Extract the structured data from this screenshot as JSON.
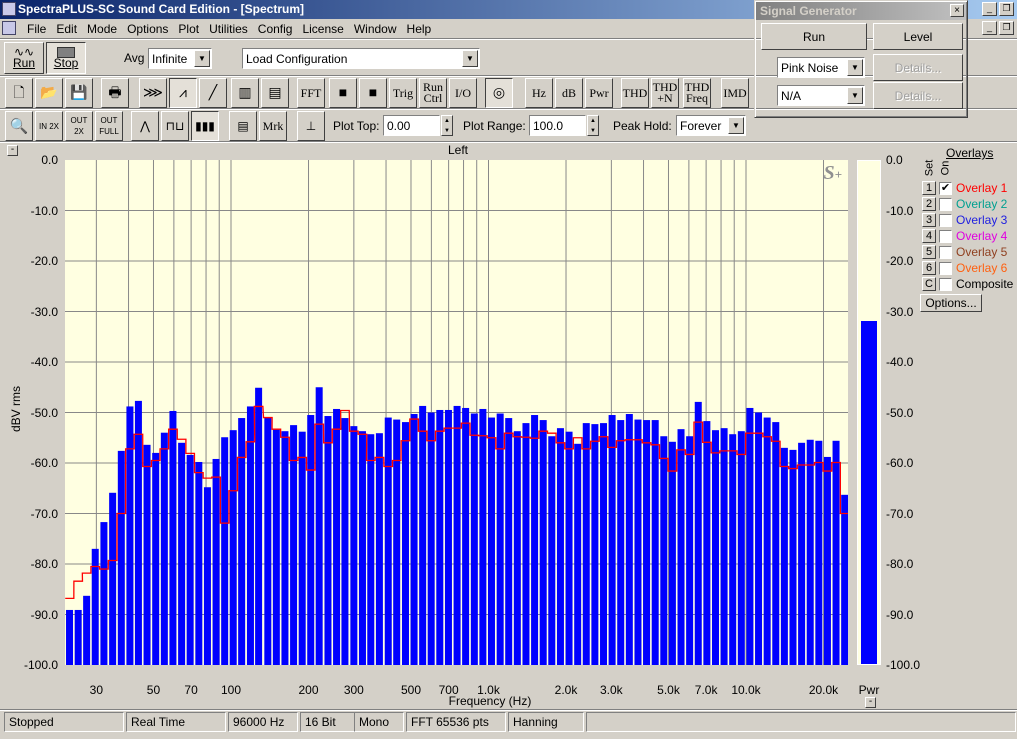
{
  "window": {
    "title": "SpectraPLUS-SC Sound Card Edition - [Spectrum]"
  },
  "menu": [
    "File",
    "Edit",
    "Mode",
    "Options",
    "Plot",
    "Utilities",
    "Config",
    "License",
    "Window",
    "Help"
  ],
  "toolbar1": {
    "run": "Run",
    "stop": "Stop",
    "avg_label": "Avg",
    "avg_value": "Infinite",
    "config_value": "Load Configuration"
  },
  "toolbar2": [
    {
      "name": "new-icon",
      "label": ""
    },
    {
      "name": "open-icon",
      "label": ""
    },
    {
      "name": "save-icon",
      "label": ""
    },
    {
      "name": "print-icon",
      "label": ""
    },
    {
      "name": "time-series-icon",
      "label": ""
    },
    {
      "name": "spectrum-icon",
      "label": ""
    },
    {
      "name": "phase-icon",
      "label": ""
    },
    {
      "name": "spectrogram-icon",
      "label": ""
    },
    {
      "name": "3d-surface-icon",
      "label": ""
    },
    {
      "name": "fft-button",
      "label": "FFT"
    },
    {
      "name": "scale-icon",
      "label": ""
    },
    {
      "name": "calibrate-icon",
      "label": ""
    },
    {
      "name": "trig-button",
      "label": "Trig"
    },
    {
      "name": "run-ctrl-button",
      "label": "Run Ctrl"
    },
    {
      "name": "io-button",
      "label": "I/O"
    },
    {
      "name": "generator-icon",
      "label": ""
    },
    {
      "name": "hz-button",
      "label": "Hz"
    },
    {
      "name": "db-button",
      "label": "dB"
    },
    {
      "name": "pwr-button",
      "label": "Pwr"
    },
    {
      "name": "thd-button",
      "label": "THD"
    },
    {
      "name": "thd-n-button",
      "label": "THD +N"
    },
    {
      "name": "thd-freq-button",
      "label": "THD Freq"
    },
    {
      "name": "imd-button",
      "label": "IMD"
    }
  ],
  "toolbar3": {
    "zoom_buttons": [
      {
        "name": "magnify-icon",
        "label": ""
      },
      {
        "name": "zoom-in-2x-button",
        "label": "IN 2X"
      },
      {
        "name": "zoom-out-2x-button",
        "label": "OUT 2X"
      },
      {
        "name": "zoom-out-full-button",
        "label": "OUT FULL"
      }
    ],
    "plot_type_buttons": [
      {
        "name": "line-plot-icon"
      },
      {
        "name": "step-plot-icon"
      },
      {
        "name": "bar-plot-icon"
      }
    ],
    "marker_label": "Mrk",
    "plot_top_label": "Plot Top:",
    "plot_top_value": "0.00",
    "plot_range_label": "Plot Range:",
    "plot_range_value": "100.0",
    "peak_hold_label": "Peak Hold:",
    "peak_hold_value": "Forever"
  },
  "signal_generator": {
    "title": "Signal Generator",
    "run": "Run",
    "level": "Level",
    "signal1": "Pink Noise",
    "signal2": "N/A",
    "details": "Details..."
  },
  "overlays": {
    "title": "Overlays",
    "set_label": "Set",
    "on_label": "On",
    "options": "Options...",
    "items": [
      {
        "set": "1",
        "label": "Overlay 1",
        "on": true,
        "color": "#ff0000"
      },
      {
        "set": "2",
        "label": "Overlay 2",
        "on": false,
        "color": "#00a090"
      },
      {
        "set": "3",
        "label": "Overlay 3",
        "on": false,
        "color": "#2020e0"
      },
      {
        "set": "4",
        "label": "Overlay 4",
        "on": false,
        "color": "#e000e0"
      },
      {
        "set": "5",
        "label": "Overlay 5",
        "on": false,
        "color": "#904020"
      },
      {
        "set": "6",
        "label": "Overlay 6",
        "on": false,
        "color": "#ff6010"
      },
      {
        "set": "C",
        "label": "Composite",
        "on": false,
        "color": "#000000"
      }
    ]
  },
  "status": [
    "Stopped",
    "Real Time",
    "96000 Hz",
    "16 Bit",
    "Mono",
    "FFT 65536 pts",
    "Hanning"
  ],
  "chart_data": {
    "type": "bar",
    "title": "Left",
    "xlabel": "Frequency (Hz)",
    "ylabel": "dBV rms",
    "xscale": "log",
    "ylim": [
      -100,
      0
    ],
    "xlim": [
      22.6,
      24800
    ],
    "grid": true,
    "yticks": [
      "0.0",
      "-10.0",
      "-20.0",
      "-30.0",
      "-40.0",
      "-50.0",
      "-60.0",
      "-70.0",
      "-80.0",
      "-90.0",
      "-100.0"
    ],
    "xticks": [
      {
        "v": 30,
        "t": "30"
      },
      {
        "v": 50,
        "t": "50"
      },
      {
        "v": 70,
        "t": "70"
      },
      {
        "v": 100,
        "t": "100"
      },
      {
        "v": 200,
        "t": "200"
      },
      {
        "v": 300,
        "t": "300"
      },
      {
        "v": 500,
        "t": "500"
      },
      {
        "v": 700,
        "t": "700"
      },
      {
        "v": 1000,
        "t": "1.0k"
      },
      {
        "v": 2000,
        "t": "2.0k"
      },
      {
        "v": 3000,
        "t": "3.0k"
      },
      {
        "v": 5000,
        "t": "5.0k"
      },
      {
        "v": 7000,
        "t": "7.0k"
      },
      {
        "v": 10000,
        "t": "10.0k"
      },
      {
        "v": 20000,
        "t": "20.0k"
      }
    ],
    "bar_color": "#0000ff",
    "overlay_color": "#ff0000",
    "background": "#ffffe1",
    "x_hz": [
      23.6,
      25.5,
      27.5,
      29.7,
      32.1,
      34.7,
      37.5,
      40.5,
      43.7,
      47.2,
      51,
      55.1,
      59.5,
      64.3,
      69.4,
      75,
      81,
      87.5,
      94.5,
      102,
      110,
      119,
      128,
      139,
      150,
      162,
      175,
      189,
      204,
      220,
      238,
      257,
      277,
      300,
      324,
      349,
      377,
      408,
      440,
      476,
      514,
      555,
      599,
      647,
      699,
      755,
      815,
      881,
      951,
      1027,
      1110,
      1198,
      1294,
      1398,
      1510,
      1631,
      1761,
      1903,
      2055,
      2220,
      2397,
      2589,
      2797,
      3020,
      3262,
      3523,
      3806,
      4110,
      4440,
      4795,
      5178,
      5593,
      6041,
      6525,
      7047,
      7612,
      8221,
      8879,
      9590,
      10357,
      11187,
      12082,
      13050,
      14094,
      15223,
      16441,
      17757,
      19179,
      20714,
      22372,
      24163
    ],
    "values": [
      -89.1,
      -89.1,
      -86.3,
      -77.0,
      -71.7,
      -65.9,
      -57.6,
      -48.8,
      -47.7,
      -56.4,
      -58.0,
      -54.0,
      -49.7,
      -56.0,
      -58.4,
      -59.8,
      -64.8,
      -59.2,
      -54.9,
      -53.5,
      -51.1,
      -48.8,
      -45.1,
      -51.0,
      -53.4,
      -53.7,
      -52.5,
      -53.8,
      -50.5,
      -45.0,
      -50.7,
      -49.3,
      -51.1,
      -52.7,
      -53.7,
      -54.3,
      -54.1,
      -51.0,
      -51.4,
      -51.9,
      -50.3,
      -48.7,
      -50.0,
      -49.5,
      -49.5,
      -48.7,
      -49.1,
      -50.2,
      -49.3,
      -51.0,
      -50.2,
      -51.1,
      -53.7,
      -52.1,
      -50.5,
      -51.5,
      -54.7,
      -53.1,
      -53.8,
      -56.2,
      -52.1,
      -52.3,
      -52.1,
      -50.5,
      -51.5,
      -50.3,
      -51.4,
      -51.5,
      -51.5,
      -54.7,
      -55.8,
      -53.3,
      -54.7,
      -47.9,
      -51.7,
      -53.5,
      -53.1,
      -54.3,
      -53.7,
      -49.1,
      -50.0,
      -51.0,
      -51.9,
      -57.0,
      -57.4,
      -56.0,
      -55.4,
      -55.6,
      -58.8,
      -55.6,
      -66.3
    ],
    "overlay1": [
      -86.8,
      -83.4,
      -81.8,
      -80.5,
      -81.0,
      -79.3,
      -70.0,
      -57.2,
      -54.3,
      -60.7,
      -59.5,
      -57.2,
      -53.3,
      -55.3,
      -58.1,
      -61.9,
      -63.0,
      -62.8,
      -71.9,
      -65.5,
      -58.9,
      -55.8,
      -48.8,
      -51.0,
      -53.3,
      -54.9,
      -59.5,
      -58.9,
      -61.4,
      -52.3,
      -56.0,
      -53.3,
      -49.6,
      -53.7,
      -54.3,
      -59.5,
      -58.9,
      -60.7,
      -59.5,
      -55.6,
      -51.3,
      -53.7,
      -55.6,
      -53.7,
      -53.1,
      -53.1,
      -52.1,
      -54.5,
      -54.6,
      -55.0,
      -57.2,
      -54.1,
      -54.8,
      -54.9,
      -55.1,
      -53.7,
      -54.1,
      -56.0,
      -57.2,
      -55.0,
      -57.2,
      -55.7,
      -54.8,
      -56.9,
      -55.6,
      -55.4,
      -55.4,
      -56.0,
      -56.4,
      -59.1,
      -61.6,
      -57.4,
      -58.3,
      -51.9,
      -55.9,
      -58.0,
      -57.6,
      -57.6,
      -58.3,
      -54.1,
      -54.1,
      -54.8,
      -55.7,
      -60.7,
      -61.1,
      -60.4,
      -60.4,
      -59.9,
      -61.6,
      -59.9,
      -70.0
    ],
    "overlay1_end": -93,
    "pwr": {
      "label": "Pwr",
      "value": -32.1
    }
  }
}
